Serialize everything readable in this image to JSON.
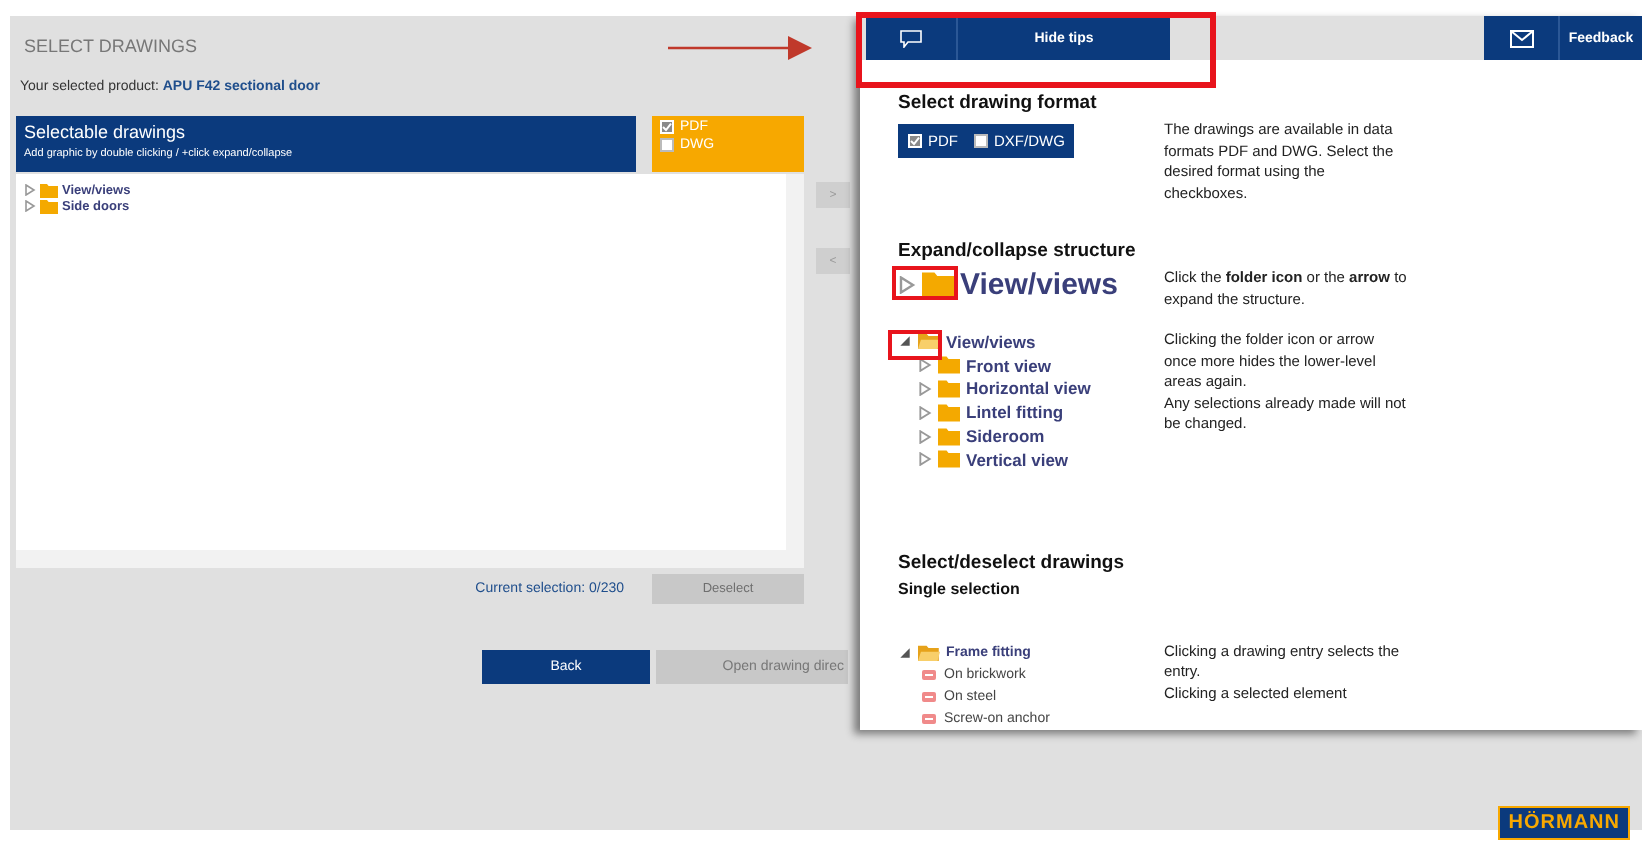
{
  "page": {
    "title": "SELECT DRAWINGS",
    "product_label": "Your selected product:",
    "product_name": "APU F42 sectional door"
  },
  "selectable": {
    "title": "Selectable drawings",
    "hint": "Add graphic by double clicking / +click expand/collapse"
  },
  "formats": [
    {
      "label": "PDF",
      "checked": true
    },
    {
      "label": "DWG",
      "checked": false
    }
  ],
  "tree": [
    {
      "label": "View/views",
      "expanded": false
    },
    {
      "label": "Side doors",
      "expanded": false
    }
  ],
  "move_buttons": [
    ">",
    "<"
  ],
  "selection": {
    "text": "Current selection: 0/230",
    "deselect": "Deselect"
  },
  "actions": [
    {
      "label": "Back",
      "disabled": false
    },
    {
      "label": "Open drawing direc",
      "disabled": true
    }
  ],
  "tips": {
    "tab": "Hide tips",
    "feedback": "Feedback",
    "sections": [
      {
        "heading": "Select drawing format",
        "kind": "formats",
        "formats": [
          {
            "label": "PDF",
            "checked": true
          },
          {
            "label": "DXF/DWG",
            "checked": false
          }
        ],
        "text": [
          "The drawings are available in data formats PDF and DWG. Select the desired format using the checkboxes."
        ]
      },
      {
        "heading": "Expand/collapse structure",
        "kind": "big_tree",
        "tree": [
          {
            "label": "View/views",
            "expanded": false
          }
        ],
        "text": [
          "Click the **folder icon** or the **arrow** to expand the structure."
        ]
      },
      {
        "kind": "tree",
        "tree": [
          {
            "label": "View/views",
            "kind": "folder",
            "expanded": true,
            "children": [
              {
                "label": "Front view",
                "kind": "folder",
                "expanded": false
              },
              {
                "label": "Horizontal view",
                "kind": "folder",
                "expanded": false
              },
              {
                "label": "Lintel fitting",
                "kind": "folder",
                "expanded": false
              },
              {
                "label": "Sideroom",
                "kind": "folder",
                "expanded": false
              },
              {
                "label": "Vertical view",
                "kind": "folder",
                "expanded": false
              }
            ]
          }
        ],
        "text": [
          "Clicking the folder icon or arrow once more hides the lower-level areas again.",
          "Any selections already made will not be changed."
        ]
      },
      {
        "heading": "Select/deselect drawings",
        "subheading": "Single selection",
        "kind": "tree",
        "tree": [
          {
            "label": "Frame fitting",
            "kind": "folder",
            "expanded": true,
            "children": [
              {
                "label": "On brickwork",
                "kind": "drawing"
              },
              {
                "label": "On steel",
                "kind": "drawing"
              },
              {
                "label": "Screw-on anchor",
                "kind": "drawing"
              }
            ]
          }
        ],
        "text": [
          "Clicking a drawing entry selects the entry.",
          "Clicking a selected element"
        ]
      }
    ]
  },
  "logo": "HÖRMANN"
}
